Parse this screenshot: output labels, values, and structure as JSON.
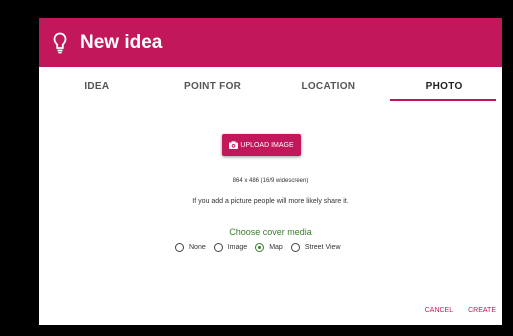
{
  "dialog": {
    "title": "New idea",
    "icon": "lightbulb-icon",
    "accent_color": "#c2185b"
  },
  "tabs": [
    {
      "label": "IDEA",
      "active": false
    },
    {
      "label": "POINT FOR",
      "active": false
    },
    {
      "label": "LOCATION",
      "active": false
    },
    {
      "label": "PHOTO",
      "active": true
    }
  ],
  "photo": {
    "upload_label": "UPLOAD IMAGE",
    "upload_icon": "camera-icon",
    "dimensions_text": "864 x 486 (16/9 widescreen)",
    "hint_text": "If you add a picture people will more likely share it."
  },
  "cover_media": {
    "title": "Choose cover media",
    "title_color": "#3a7d2c",
    "options": [
      {
        "label": "None",
        "checked": false
      },
      {
        "label": "Image",
        "checked": false
      },
      {
        "label": "Map",
        "checked": true
      },
      {
        "label": "Street View",
        "checked": false
      }
    ]
  },
  "actions": {
    "cancel_label": "CANCEL",
    "create_label": "CREATE"
  }
}
